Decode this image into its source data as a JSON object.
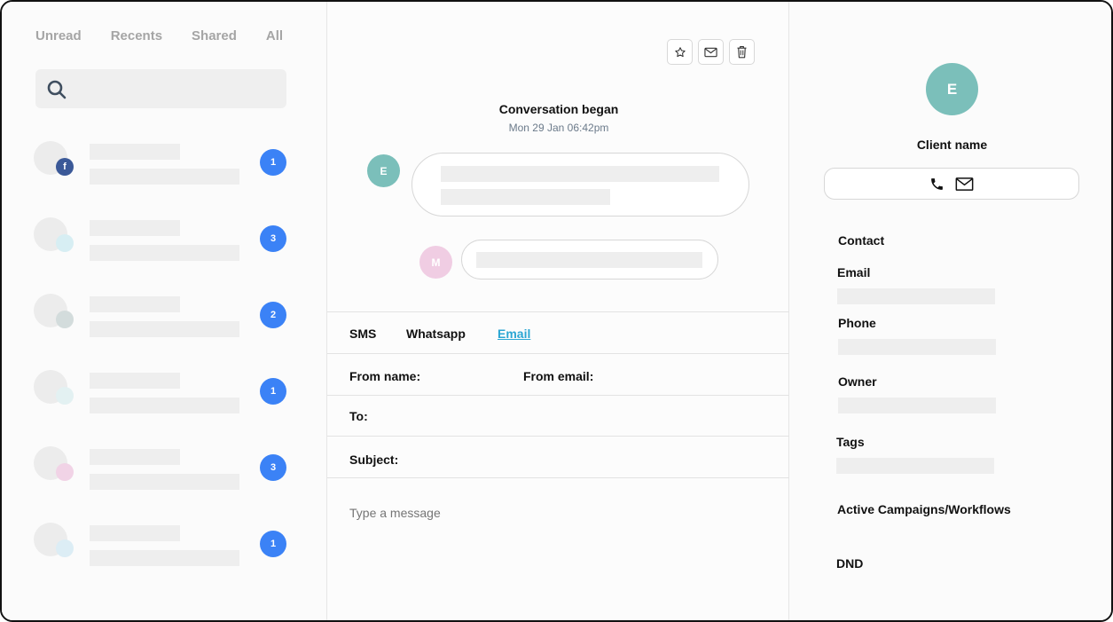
{
  "tabs": [
    "Unread",
    "Recents",
    "Shared",
    "All"
  ],
  "conversations": [
    {
      "count": "1",
      "mini": "facebook"
    },
    {
      "count": "3",
      "mini": "light-blue"
    },
    {
      "count": "2",
      "mini": "gray"
    },
    {
      "count": "1",
      "mini": "pale-cyan"
    },
    {
      "count": "3",
      "mini": "pink"
    },
    {
      "count": "1",
      "mini": "pale-blue"
    }
  ],
  "toolbar": {
    "icons": [
      "star-icon",
      "mail-icon",
      "trash-icon"
    ]
  },
  "conversation": {
    "began_label": "Conversation began",
    "began_time": "Mon 29 Jan 06:42pm",
    "client_initial": "E",
    "user_initial": "M"
  },
  "channels": {
    "sms": "SMS",
    "whatsapp": "Whatsapp",
    "email": "Email",
    "active": "Email"
  },
  "email_form": {
    "from_name": "From name:",
    "from_email": "From email:",
    "to": "To:",
    "subject": "Subject:",
    "placeholder": "Type a message"
  },
  "client": {
    "initial": "E",
    "name": "Client name",
    "contact_heading": "Contact",
    "email_label": "Email",
    "phone_label": "Phone",
    "owner_label": "Owner",
    "tags_label": "Tags",
    "campaigns_label": "Active Campaigns/Workflows",
    "dnd_label": "DND"
  },
  "colors": {
    "accent_blue": "#3b82f6",
    "teal": "#7bbfba",
    "pink": "#f0cde3",
    "link": "#2ba6d3",
    "facebook": "#3b5998"
  }
}
